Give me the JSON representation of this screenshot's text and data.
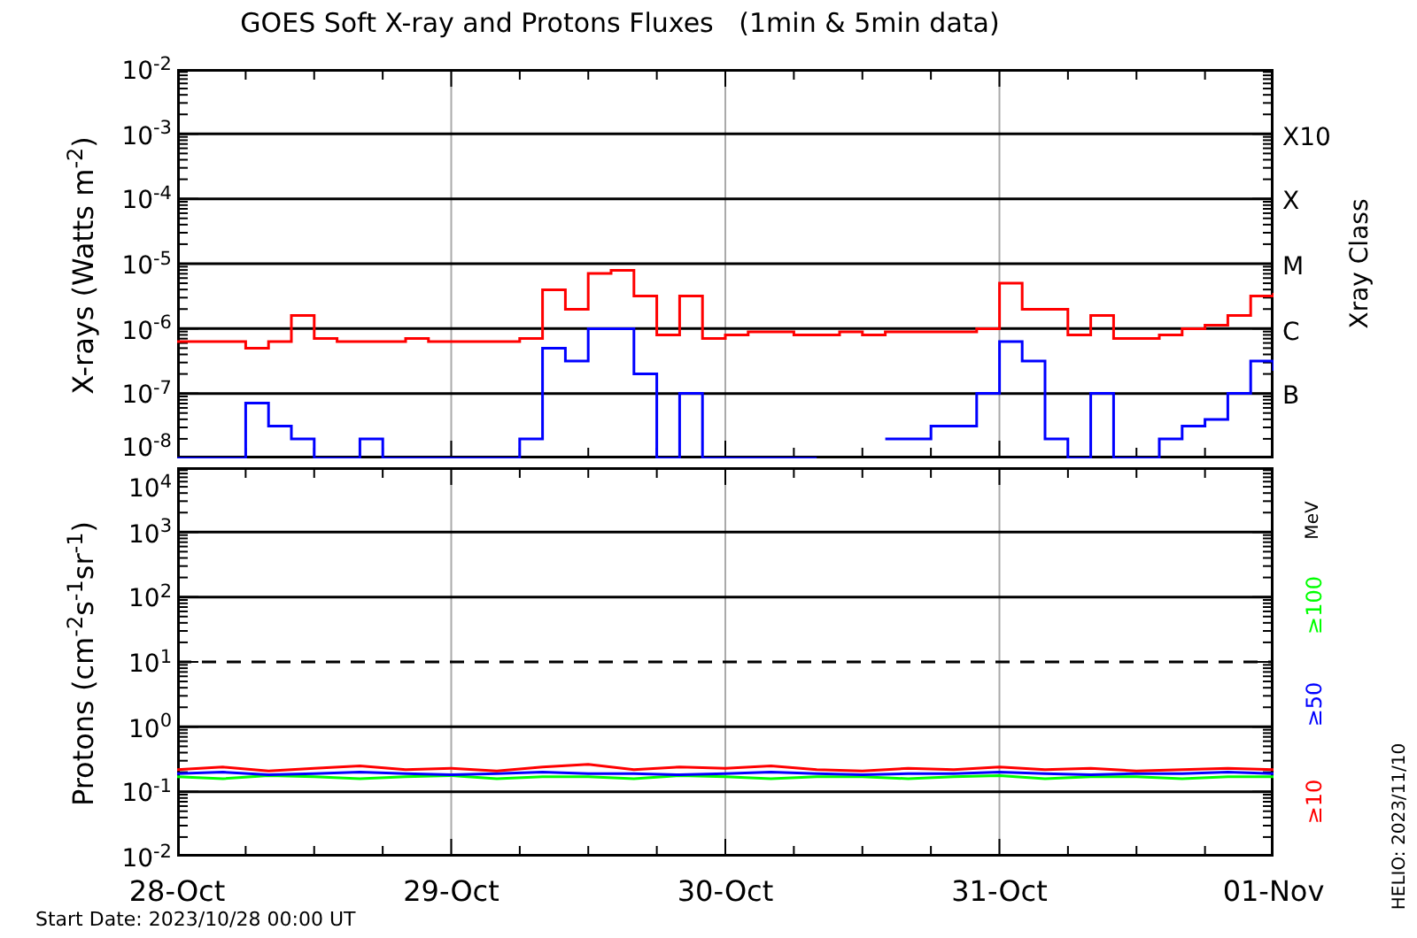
{
  "title": "GOES Soft X-ray and Protons Fluxes   (1min & 5min data)",
  "xray_panel": {
    "y_axis_title": "X-rays (Watts m$^{-2}$)",
    "y_tick_labels": [
      "10$^{-2}$",
      "10$^{-3}$",
      "10$^{-4}$",
      "10$^{-5}$",
      "10$^{-6}$",
      "10$^{-7}$",
      "10$^{-8}$"
    ],
    "class_axis": {
      "title": "Xray Class",
      "labels": [
        "X10",
        "X",
        "M",
        "C",
        "B"
      ]
    }
  },
  "proton_panel": {
    "y_axis_title": "Protons (cm$^{-2}$s$^{-1}$sr$^{-1}$)",
    "y_tick_labels": [
      "10$^{4}$",
      "10$^{3}$",
      "10$^{2}$",
      "10$^{1}$",
      "10$^{0}$",
      "10$^{-1}$",
      "10$^{-2}$"
    ],
    "unit": "MeV",
    "legend": [
      {
        "label": "≥100",
        "color": "#00ff00"
      },
      {
        "label": "≥50",
        "color": "#0000ff"
      },
      {
        "label": "≥10",
        "color": "#ff0000"
      }
    ],
    "x_labels": [
      "28-Oct",
      "29-Oct",
      "30-Oct",
      "31-Oct",
      "01-Nov"
    ]
  },
  "start_date": "Start Date: 2023/10/28 00:00 UT",
  "stamp": "HELIO: 2023/11/10"
}
